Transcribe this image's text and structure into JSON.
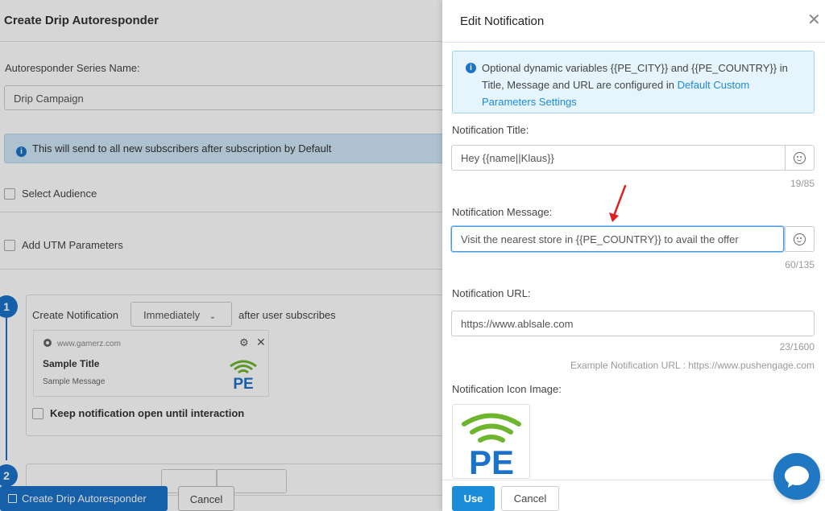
{
  "background": {
    "title": "Create Drip Autoresponder",
    "series_label": "Autoresponder Series Name:",
    "series_value": "Drip Campaign",
    "info_text": "This will send to all new subscribers after subscription by Default",
    "select_audience": "Select Audience",
    "add_utm": "Add UTM Parameters",
    "step1_number": "1",
    "step2_number": "2",
    "create_notification_label": "Create Notification",
    "timing_value": "Immediately",
    "after_text": "after user subscribes",
    "preview": {
      "site": "www.gamerz.com",
      "title": "Sample Title",
      "message": "Sample Message"
    },
    "keep_open": "Keep notification open until interaction",
    "create_button": "Create Drip Autoresponder",
    "cancel_button": "Cancel"
  },
  "drawer": {
    "title": "Edit Notification",
    "info_text": "Optional dynamic variables {{PE_CITY}} and {{PE_COUNTRY}} in Title, Message and URL are configured in ",
    "info_link": "Default Custom Parameters Settings",
    "title_label": "Notification Title:",
    "title_value": "Hey {{name||Klaus}}",
    "title_count": "19/85",
    "message_label": "Notification Message:",
    "message_value": "Visit the nearest store in {{PE_COUNTRY}} to avail the offer",
    "message_count": "60/135",
    "url_label": "Notification URL:",
    "url_value": "https://www.ablsale.com",
    "url_count": "23/1600",
    "url_example": "Example Notification URL : https://www.pushengage.com",
    "icon_label": "Notification Icon Image:",
    "use_button": "Use",
    "cancel_button": "Cancel"
  },
  "logo_text": "PE",
  "colors": {
    "primary": "#1a8cd8",
    "logo_green": "#6cb52d",
    "logo_blue": "#1a73c9",
    "arrow_red": "#e02020"
  }
}
